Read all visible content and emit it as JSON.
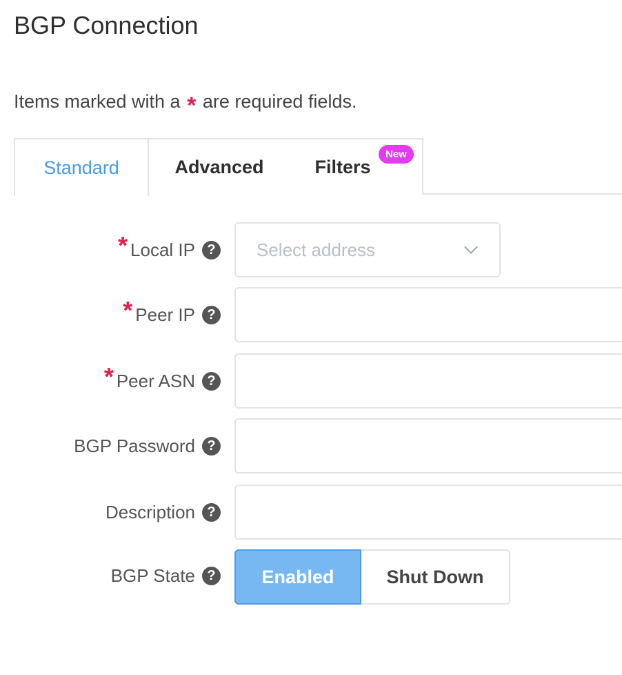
{
  "page": {
    "title": "BGP Connection",
    "required_note_before": "Items marked with a",
    "required_star": "*",
    "required_note_after": "are required fields."
  },
  "tabs": [
    {
      "label": "Standard",
      "active": true
    },
    {
      "label": "Advanced",
      "active": false
    },
    {
      "label": "Filters",
      "active": false,
      "badge": "New"
    }
  ],
  "form": {
    "local_ip": {
      "label": "Local IP",
      "required": true,
      "placeholder": "Select address",
      "value": ""
    },
    "peer_ip": {
      "label": "Peer IP",
      "required": true,
      "value": ""
    },
    "peer_asn": {
      "label": "Peer ASN",
      "required": true,
      "value": ""
    },
    "bgp_password": {
      "label": "BGP Password",
      "required": false,
      "value": ""
    },
    "description": {
      "label": "Description",
      "required": false,
      "value": ""
    },
    "bgp_state": {
      "label": "BGP State",
      "options": [
        "Enabled",
        "Shut Down"
      ],
      "selected": "Enabled"
    }
  },
  "icons": {
    "help": "question-circle-icon",
    "dropdown": "chevron-down-icon",
    "required": "asterisk"
  },
  "colors": {
    "accent": "#4a9be6",
    "required": "#e0204a",
    "badge": "#e23bf0",
    "toggle_active": "#78b8f2"
  }
}
